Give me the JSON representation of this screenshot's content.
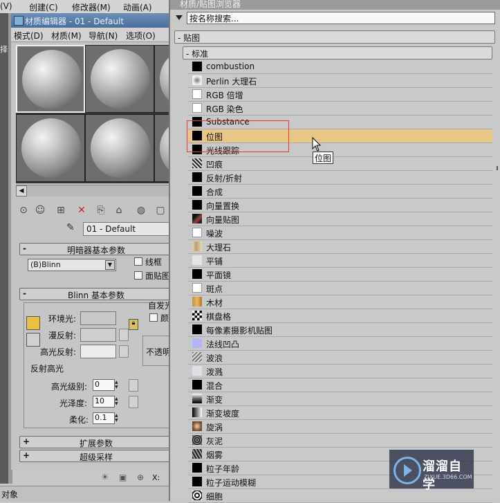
{
  "app_menu": {
    "view": "(V)",
    "create": "创建(C)",
    "modifiers": "修改器(M)",
    "animation": "动画(A)"
  },
  "left_labels": {
    "strip_text": "择",
    "status_text": "对象"
  },
  "material_editor": {
    "title": "材质编辑器 - 01 - Default",
    "menu": [
      "模式(D)",
      "材质(M)",
      "导航(N)",
      "选项(O)"
    ],
    "material_name": "01 - Default",
    "shader_rollout": "明暗器基本参数",
    "shader_type": "(B)Blinn",
    "wire_label": "线框",
    "faceted_label": "面贴图",
    "blinn_rollout": "Blinn 基本参数",
    "self_illum_label": "自发光",
    "color_label": "颜",
    "ambient_label": "环境光:",
    "diffuse_label": "漫反射:",
    "specular_label": "高光反射:",
    "opacity_label": "不透明",
    "spec_highlights_label": "反射高光",
    "spec_level_label": "高光级别:",
    "spec_level_value": "0",
    "gloss_label": "光泽度:",
    "gloss_value": "10",
    "soften_label": "柔化:",
    "soften_value": "0.1",
    "extended_rollout": "扩展参数",
    "supersampling_rollout": "超级采样",
    "coord_label": "X:"
  },
  "browser": {
    "title": "材质/贴图浏览器",
    "search_placeholder": "按名称搜索...",
    "category": "- 贴图",
    "subcategory": "- 标准",
    "tooltip": "位图",
    "highlight_color": "#e7c688",
    "items": [
      {
        "name": "combustion",
        "icon": "black"
      },
      {
        "name": "Perlin 大理石",
        "icon": "perlin"
      },
      {
        "name": "RGB 倍增",
        "icon": "white"
      },
      {
        "name": "RGB 染色",
        "icon": "white"
      },
      {
        "name": "Substance",
        "icon": "black"
      },
      {
        "name": "位图",
        "icon": "black"
      },
      {
        "name": "光线跟踪",
        "icon": "black"
      },
      {
        "name": "凹痕",
        "icon": "dent"
      },
      {
        "name": "反射/折射",
        "icon": "black"
      },
      {
        "name": "合成",
        "icon": "black"
      },
      {
        "name": "向量置换",
        "icon": "black"
      },
      {
        "name": "向量贴图",
        "icon": "vecmap"
      },
      {
        "name": "噪波",
        "icon": "white"
      },
      {
        "name": "大理石",
        "icon": "marble"
      },
      {
        "name": "平铺",
        "icon": "light"
      },
      {
        "name": "平面镜",
        "icon": "black"
      },
      {
        "name": "斑点",
        "icon": "white"
      },
      {
        "name": "木材",
        "icon": "wood"
      },
      {
        "name": "棋盘格",
        "icon": "checker"
      },
      {
        "name": "每像素摄影机贴图",
        "icon": "black"
      },
      {
        "name": "法线凹凸",
        "icon": "normal"
      },
      {
        "name": "波浪",
        "icon": "waves"
      },
      {
        "name": "泼溅",
        "icon": "splat"
      },
      {
        "name": "混合",
        "icon": "black"
      },
      {
        "name": "渐变",
        "icon": "gradient"
      },
      {
        "name": "渐变坡度",
        "icon": "gradramp"
      },
      {
        "name": "旋涡",
        "icon": "swirl"
      },
      {
        "name": "灰泥",
        "icon": "stucco"
      },
      {
        "name": "烟雾",
        "icon": "smoke"
      },
      {
        "name": "粒子年龄",
        "icon": "black"
      },
      {
        "name": "粒子运动模糊",
        "icon": "black"
      },
      {
        "name": "细胞",
        "icon": "cellular"
      }
    ]
  },
  "watermark": {
    "title": "溜溜自学",
    "url": "ZIXUE.3D66.COM"
  }
}
